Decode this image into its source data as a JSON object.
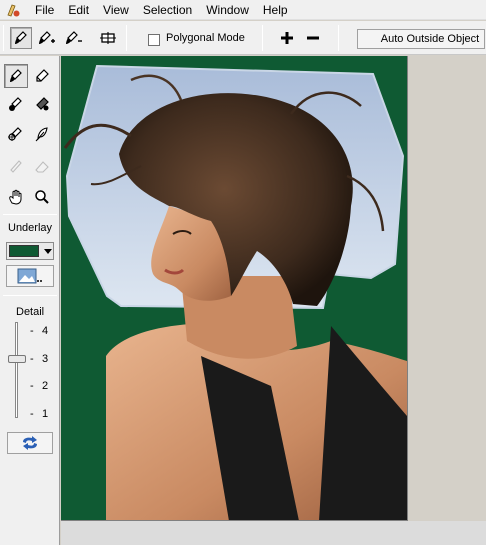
{
  "menu": {
    "items": [
      {
        "label": "File"
      },
      {
        "label": "Edit"
      },
      {
        "label": "View"
      },
      {
        "label": "Selection"
      },
      {
        "label": "Window"
      },
      {
        "label": "Help"
      }
    ]
  },
  "toolbar": {
    "polygonal_mode_label": "Polygonal Mode",
    "polygonal_mode_checked": false,
    "auto_outside_label": "Auto Outside Object"
  },
  "left_panel": {
    "underlay_label": "Underlay",
    "underlay_color": "#0f5a33",
    "detail_label": "Detail",
    "detail_value": 3,
    "detail_ticks": [
      "4",
      "3",
      "2",
      "1"
    ]
  },
  "canvas": {
    "background_color": "#0f5a33"
  }
}
